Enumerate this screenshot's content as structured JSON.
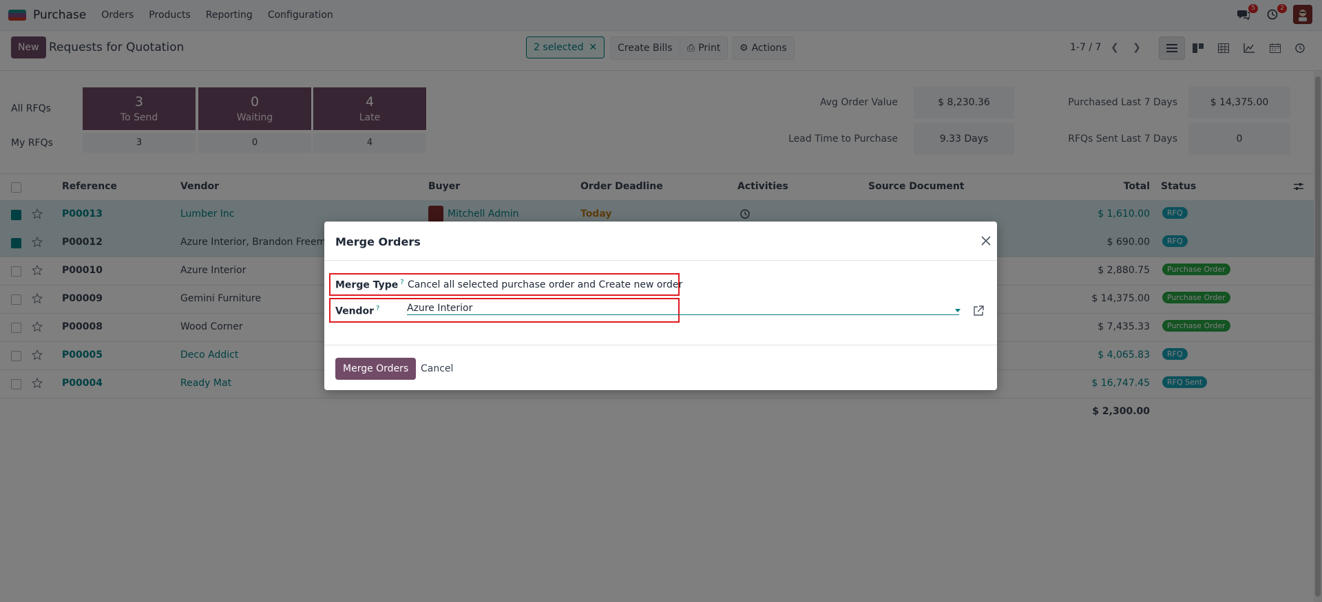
{
  "topbar": {
    "app_name": "Purchase",
    "menu": [
      "Orders",
      "Products",
      "Reporting",
      "Configuration"
    ],
    "messages_badge": "5",
    "activities_badge": "2",
    "icons": [
      "chat-icon",
      "clock-icon",
      "user-avatar"
    ]
  },
  "control": {
    "new_label": "New",
    "title": "Requests for Quotation",
    "selected_label": "2 selected",
    "create_bills": "Create Bills",
    "print": "Print",
    "actions": "Actions",
    "pager": "1-7 / 7",
    "views": [
      "list-view-icon",
      "kanban-view-icon",
      "pivot-view-icon",
      "graph-view-icon",
      "calendar-view-icon",
      "activity-view-icon"
    ],
    "active_view": "list-view-icon"
  },
  "dashboard": {
    "all_rfqs": "All RFQs",
    "my_rfqs": "My RFQs",
    "tiles": [
      {
        "num": "3",
        "label": "To Send",
        "mine": "3"
      },
      {
        "num": "0",
        "label": "Waiting",
        "mine": "0"
      },
      {
        "num": "4",
        "label": "Late",
        "mine": "4"
      }
    ],
    "stats": [
      {
        "label": "Avg Order Value",
        "value": "$ 8,230.36"
      },
      {
        "label": "Purchased Last 7 Days",
        "value": "$ 14,375.00"
      },
      {
        "label": "Lead Time to Purchase",
        "value": "9.33 Days"
      },
      {
        "label": "RFQs Sent Last 7 Days",
        "value": "0"
      }
    ]
  },
  "list": {
    "headers": {
      "reference": "Reference",
      "vendor": "Vendor",
      "buyer": "Buyer",
      "deadline": "Order Deadline",
      "activities": "Activities",
      "source": "Source Document",
      "total": "Total",
      "status": "Status"
    },
    "rows": [
      {
        "ref": "P00013",
        "vendor": "Lumber Inc",
        "buyer": "Mitchell Admin",
        "deadline": "Today",
        "total": "$ 1,610.00",
        "status": "RFQ",
        "selected": true
      },
      {
        "ref": "P00012",
        "vendor": "Azure Interior, Brandon Freeman",
        "buyer": "",
        "deadline": "",
        "total": "$ 690.00",
        "status": "RFQ",
        "selected": true
      },
      {
        "ref": "P00010",
        "vendor": "Azure Interior",
        "buyer": "",
        "deadline": "",
        "total": "$ 2,880.75",
        "status": "Purchase Order",
        "selected": false
      },
      {
        "ref": "P00009",
        "vendor": "Gemini Furniture",
        "buyer": "",
        "deadline": "",
        "total": "$ 14,375.00",
        "status": "Purchase Order",
        "selected": false
      },
      {
        "ref": "P00008",
        "vendor": "Wood Corner",
        "buyer": "",
        "deadline": "",
        "total": "$ 7,435.33",
        "status": "Purchase Order",
        "selected": false
      },
      {
        "ref": "P00005",
        "vendor": "Deco Addict",
        "buyer": "",
        "deadline": "",
        "total": "$ 4,065.83",
        "status": "RFQ",
        "selected": false
      },
      {
        "ref": "P00004",
        "vendor": "Ready Mat",
        "buyer": "",
        "deadline": "",
        "total": "$ 16,747.45",
        "status": "RFQ Sent",
        "selected": false
      }
    ],
    "sum_total": "$ 2,300.00"
  },
  "modal": {
    "title": "Merge Orders",
    "merge_type_label": "Merge Type",
    "merge_type_value": "Cancel all selected purchase order and Create new order",
    "vendor_label": "Vendor",
    "vendor_value": "Azure Interior",
    "help_mark": "?",
    "merge_button": "Merge Orders",
    "cancel_button": "Cancel"
  },
  "colors": {
    "brand": "#714b67",
    "teal": "#017e84",
    "highlight": "#e0191f"
  }
}
